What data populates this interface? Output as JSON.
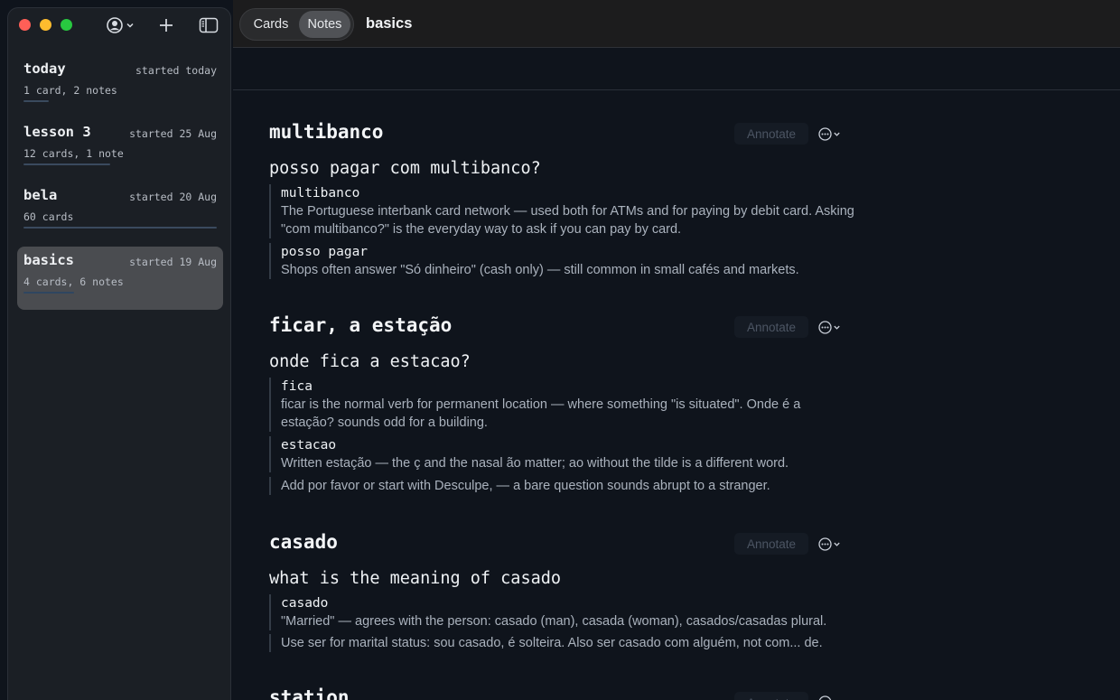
{
  "sidebar": {
    "decks": [
      {
        "name": "today",
        "started": "started today",
        "count": "1 card, 2 notes",
        "progress": 0.13
      },
      {
        "name": "lesson 3",
        "started": "started 25 Aug",
        "count": "12 cards, 1 note",
        "progress": 0.45
      },
      {
        "name": "bela",
        "started": "started 20 Aug",
        "count": "60 cards",
        "progress": 1.0
      },
      {
        "name": "basics",
        "started": "started 19 Aug",
        "count": "4 cards, 6 notes",
        "progress": 0.26,
        "selected": true
      }
    ]
  },
  "topbar": {
    "tabs": [
      "Cards",
      "Notes"
    ],
    "active_tab": "Notes",
    "title": "basics"
  },
  "main": {
    "annotate_label": "Annotate",
    "sections": [
      {
        "title": "multibanco",
        "question": "posso pagar com multibanco?",
        "notes": [
          {
            "term": "multibanco",
            "text": "The Portuguese interbank card network — used both for ATMs and for paying by debit card. Asking \"com multibanco?\" is the everyday way to ask if you can pay by card."
          },
          {
            "term": "posso pagar",
            "text": "Shops often answer \"Só dinheiro\" (cash only) — still common in small cafés and markets."
          }
        ]
      },
      {
        "title": "ficar, a estação",
        "question": "onde fica a estacao?",
        "notes": [
          {
            "term": "fica",
            "text": "ficar is the normal verb for permanent location — where something \"is situated\". Onde é a estação? sounds odd for a building."
          },
          {
            "term": "estacao",
            "text": "Written estação — the ç and the nasal ão matter; ao without the tilde is a different word."
          },
          {
            "term": "",
            "text": "Add por favor or start with Desculpe, — a bare question sounds abrupt to a stranger."
          }
        ]
      },
      {
        "title": "casado",
        "question": "what is the meaning of casado",
        "notes": [
          {
            "term": "casado",
            "text": "\"Married\" — agrees with the person: casado (man), casada (woman), casados/casadas plural."
          },
          {
            "term": "",
            "text": "Use ser for marital status: sou casado, é solteira. Also ser casado com alguém, not com... de."
          }
        ]
      },
      {
        "title": "station"
      }
    ]
  }
}
